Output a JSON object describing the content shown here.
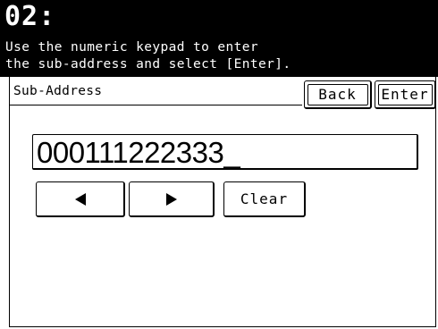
{
  "header": {
    "title": "02:",
    "instruction_line1": "Use the numeric keypad to enter",
    "instruction_line2": "the sub-address and select [Enter]."
  },
  "section": {
    "label": "Sub-Address"
  },
  "buttons": {
    "back": "Back",
    "enter": "Enter",
    "clear": "Clear"
  },
  "input": {
    "value": "000111222333_"
  },
  "icons": {
    "cursor_left": "left-arrow-icon",
    "cursor_right": "right-arrow-icon"
  },
  "colors": {
    "header_bg": "#000000",
    "header_text": "#ffffff",
    "background": "#ffffff"
  }
}
